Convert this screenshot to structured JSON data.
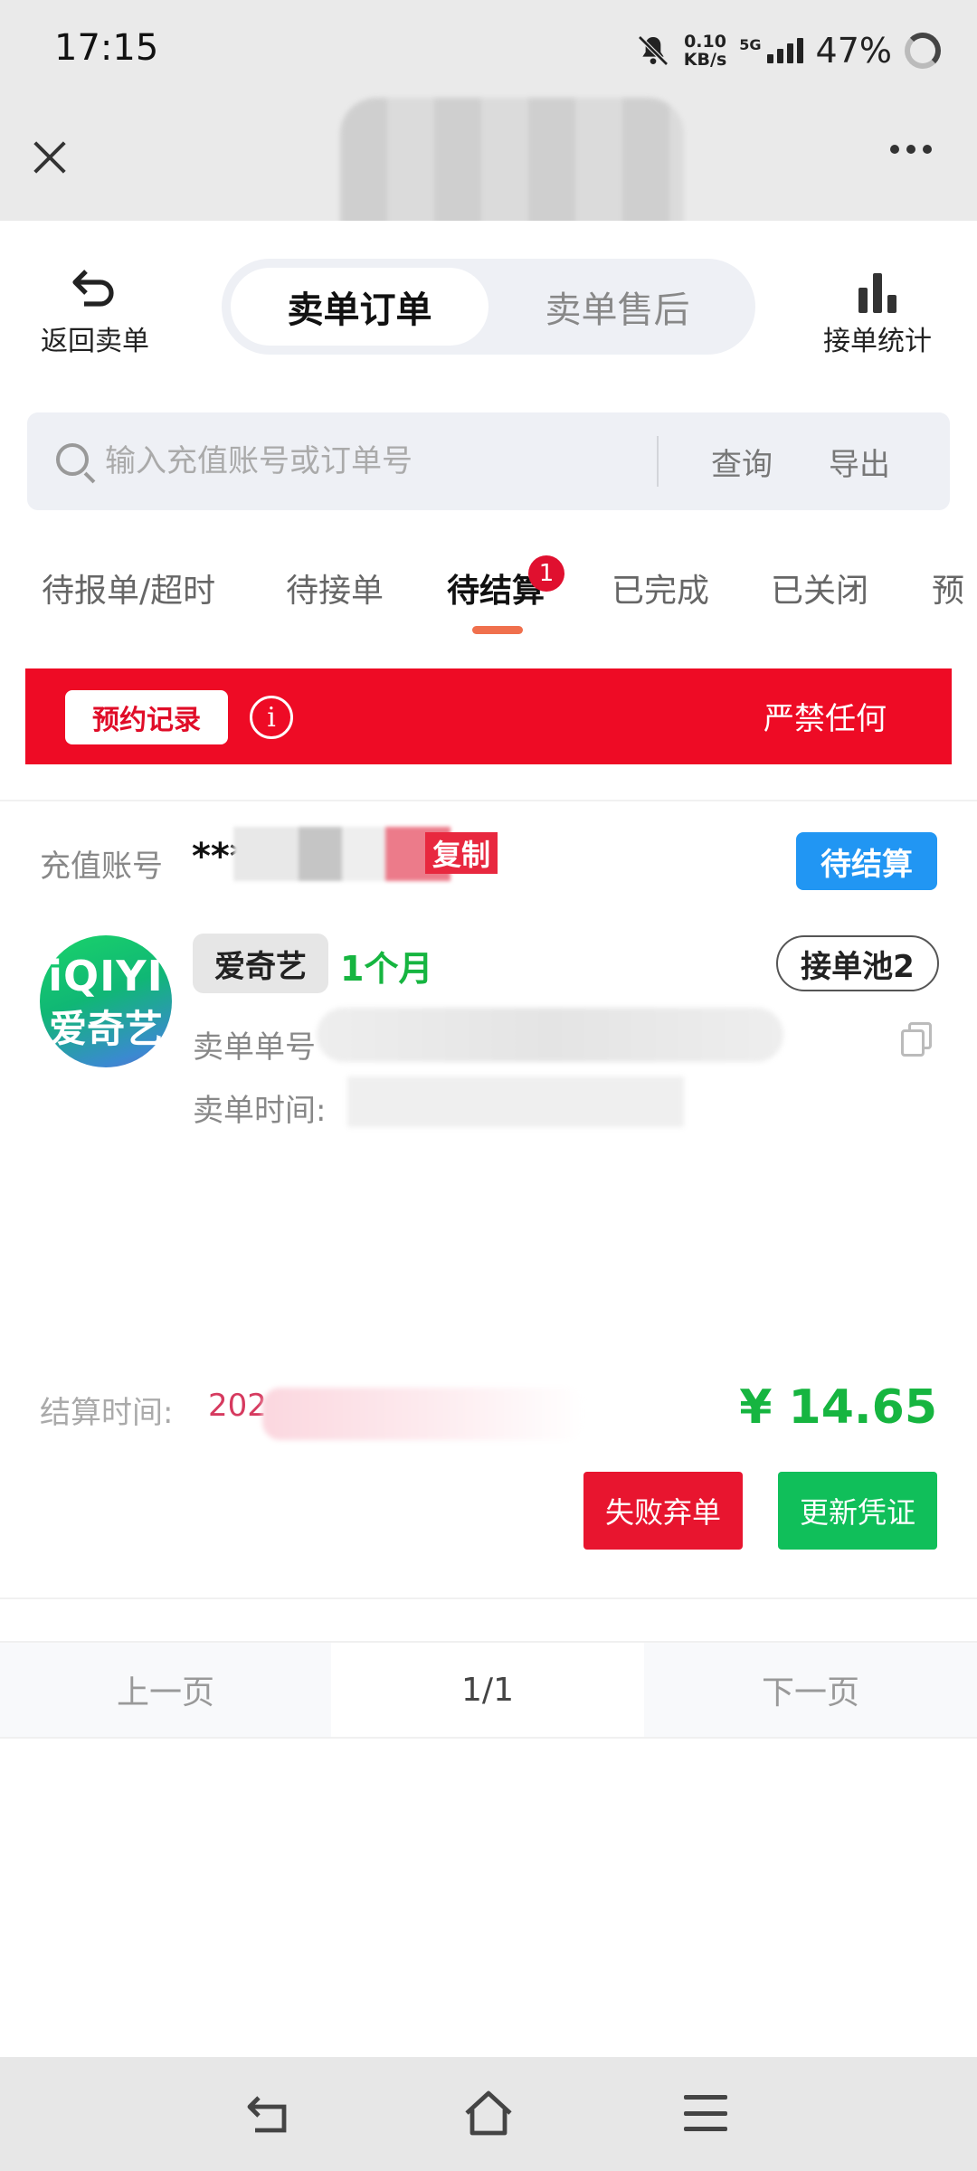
{
  "status_bar": {
    "time": "17:15",
    "net_speed_value": "0.10",
    "net_speed_unit": "KB/s",
    "network_type": "5G",
    "battery": "47%"
  },
  "header": {
    "back_label": "返回卖单",
    "segments": [
      "卖单订单",
      "卖单售后"
    ],
    "active_segment": "卖单订单",
    "stats_label": "接单统计"
  },
  "search": {
    "placeholder": "输入充值账号或订单号",
    "query_label": "查询",
    "export_label": "导出"
  },
  "tabs": {
    "items": [
      "待报单/超时",
      "待接单",
      "待结算",
      "已完成",
      "已关闭",
      "预"
    ],
    "active": "待结算",
    "badge_count": "1"
  },
  "banner": {
    "reserve_label": "预约记录",
    "info_icon": "i",
    "marquee_text": "严禁任何"
  },
  "order": {
    "account_label": "充值账号",
    "account_value": "***",
    "copy_label": "复制",
    "status": "待结算",
    "logo_en": "iQIYI",
    "logo_cn": "爱奇艺",
    "platform": "爱奇艺",
    "duration": "1个月",
    "pool": "接单池2",
    "order_no_label": "卖单单号",
    "order_time_label": "卖单时间:",
    "settle_label": "结算时间:",
    "settle_value": "202",
    "price": "¥ 14.65",
    "fail_label": "失败弃单",
    "renew_label": "更新凭证"
  },
  "pager": {
    "prev": "上一页",
    "current": "1/1",
    "next": "下一页"
  },
  "colors": {
    "accent_red": "#ee0b25",
    "status_blue": "#2196f3",
    "price_green": "#16b540",
    "renew_green": "#10bf5a",
    "tab_underline": "#f0704d"
  }
}
